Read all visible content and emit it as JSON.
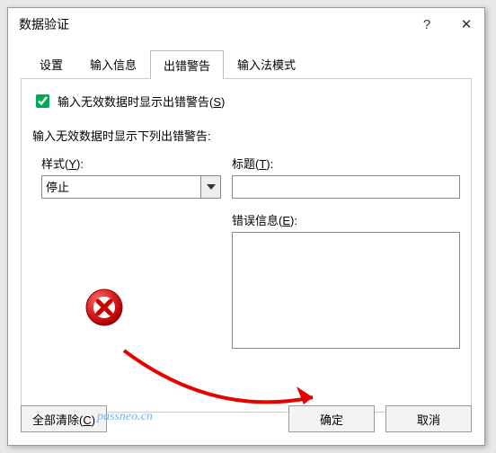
{
  "window": {
    "title": "数据验证"
  },
  "tabs": {
    "settings": "设置",
    "inputMessage": "输入信息",
    "errorAlert": "出错警告",
    "imeMode": "输入法模式"
  },
  "panel": {
    "showErrorCheckbox": "输入无效数据时显示出错警告(",
    "showErrorCheckboxKey": "S",
    "sectionLabel": "输入无效数据时显示下列出错警告:",
    "styleLabel": "样式(",
    "styleKey": "Y",
    "styleValue": "停止",
    "titleLabel": "标题(",
    "titleKey": "T",
    "titleValue": "",
    "messageLabel": "错误信息(",
    "messageKey": "E",
    "messageValue": ""
  },
  "buttons": {
    "clearAll": "全部清除(",
    "clearAllKey": "C",
    "ok": "确定",
    "cancel": "取消"
  },
  "watermark": "passneo.cn"
}
